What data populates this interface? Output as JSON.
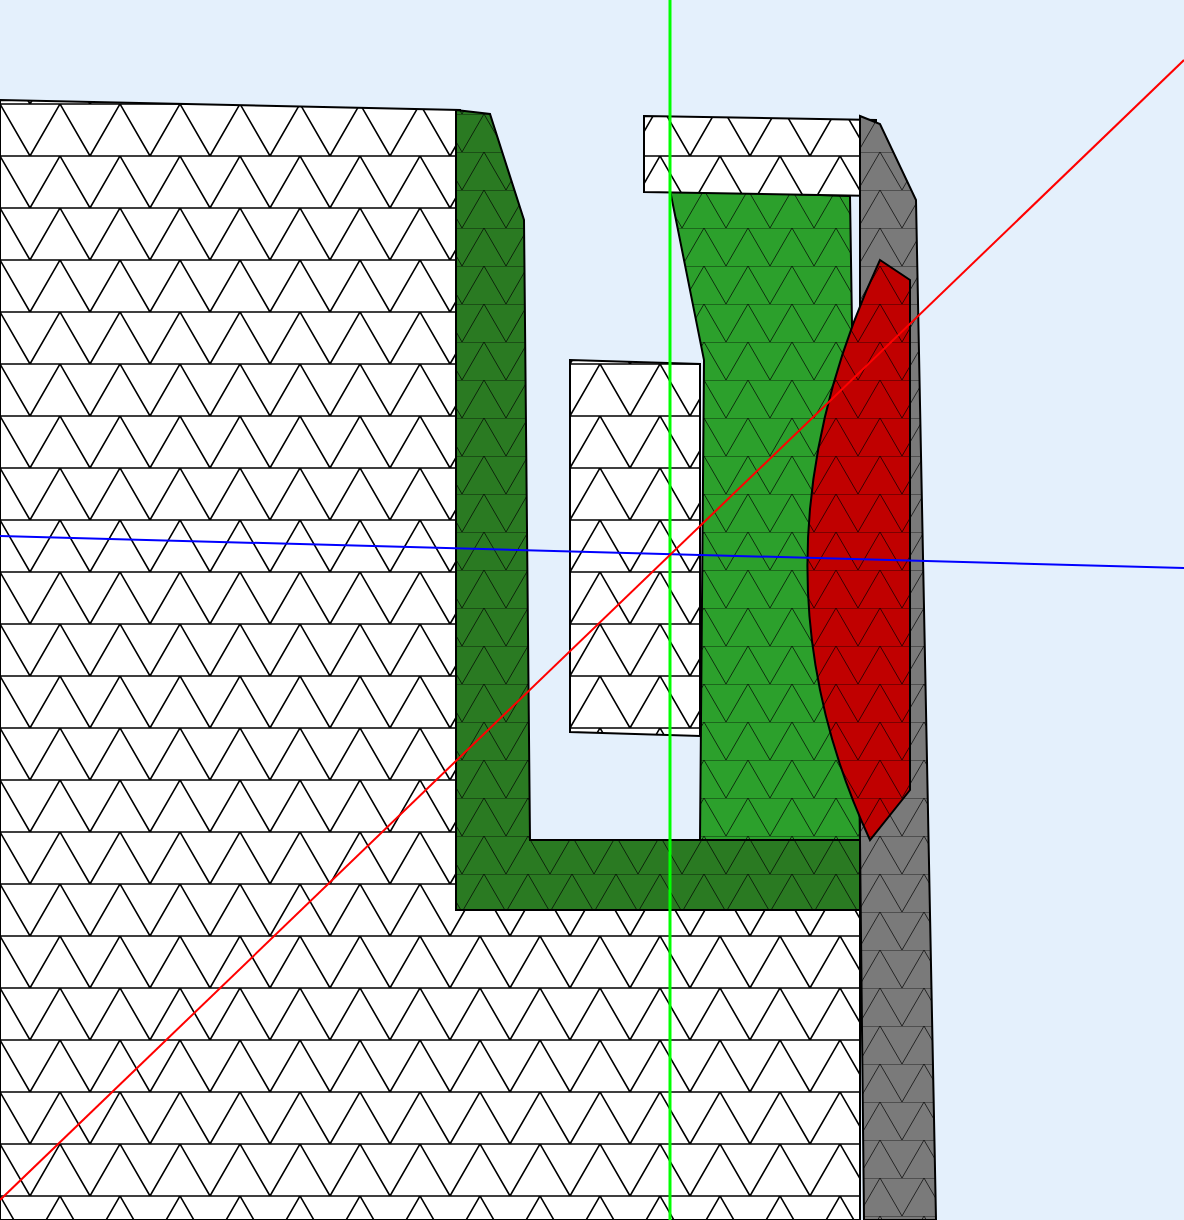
{
  "parts": [
    {
      "kind": "body",
      "color": "#ffffff"
    },
    {
      "kind": "channel",
      "color": "#2a7a22"
    },
    {
      "kind": "insert",
      "color": "#2ca02c"
    },
    {
      "kind": "cap",
      "color": "#ffffff"
    },
    {
      "kind": "block",
      "color": "#ffffff"
    },
    {
      "kind": "wall",
      "color": "#7a7a7a"
    },
    {
      "kind": "lens",
      "color": "#c00000"
    }
  ],
  "axes": [
    {
      "kind": "vertical",
      "color": "#00ff00"
    },
    {
      "kind": "horizontal",
      "color": "#0000ff"
    },
    {
      "kind": "diagonal",
      "color": "#ff0000"
    }
  ]
}
